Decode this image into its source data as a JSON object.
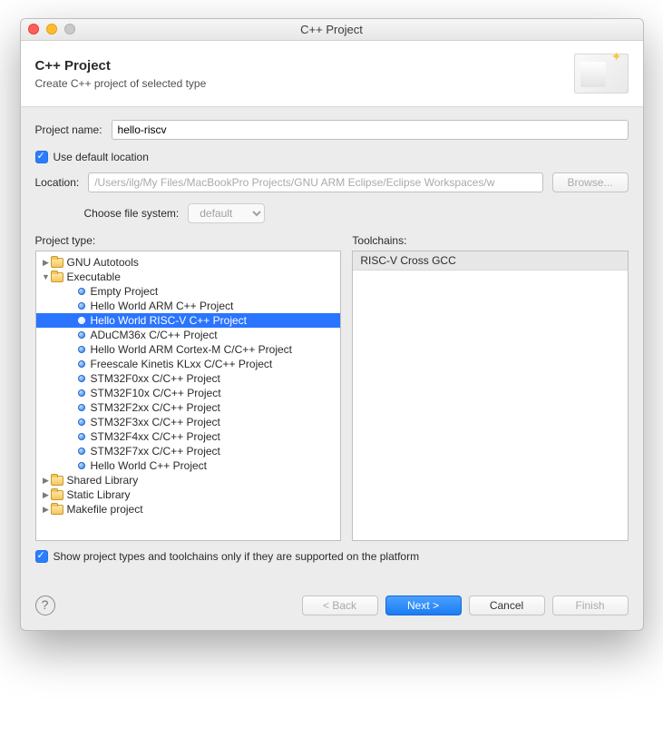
{
  "title": "C++ Project",
  "header": {
    "heading": "C++ Project",
    "sub": "Create C++ project of selected type"
  },
  "projectName": {
    "label": "Project name:",
    "value": "hello-riscv"
  },
  "defaultLoc": {
    "label": "Use default location"
  },
  "location": {
    "label": "Location:",
    "value": "/Users/ilg/My Files/MacBookPro Projects/GNU ARM Eclipse/Eclipse Workspaces/w",
    "browse": "Browse..."
  },
  "fs": {
    "label": "Choose file system:",
    "value": "default"
  },
  "cols": {
    "type": "Project type:",
    "tc": "Toolchains:"
  },
  "tree": {
    "cat": {
      "autotools": "GNU Autotools",
      "executable": "Executable",
      "shared": "Shared Library",
      "static": "Static Library",
      "make": "Makefile project"
    },
    "exe": {
      "empty": "Empty Project",
      "arm": "Hello World ARM C++ Project",
      "riscv": "Hello World RISC-V C++ Project",
      "aducm": "ADuCM36x C/C++ Project",
      "cortex": "Hello World ARM Cortex-M C/C++ Project",
      "kinetis": "Freescale Kinetis KLxx C/C++ Project",
      "f0": "STM32F0xx C/C++ Project",
      "f1": "STM32F10x C/C++ Project",
      "f2": "STM32F2xx C/C++ Project",
      "f3": "STM32F3xx C/C++ Project",
      "f4": "STM32F4xx C/C++ Project",
      "f7": "STM32F7xx C/C++ Project",
      "hw": "Hello World C++ Project"
    }
  },
  "toolchain": "RISC-V Cross GCC",
  "supported": {
    "label": "Show project types and toolchains only if they are supported on the platform"
  },
  "buttons": {
    "back": "< Back",
    "next": "Next >",
    "cancel": "Cancel",
    "finish": "Finish"
  }
}
